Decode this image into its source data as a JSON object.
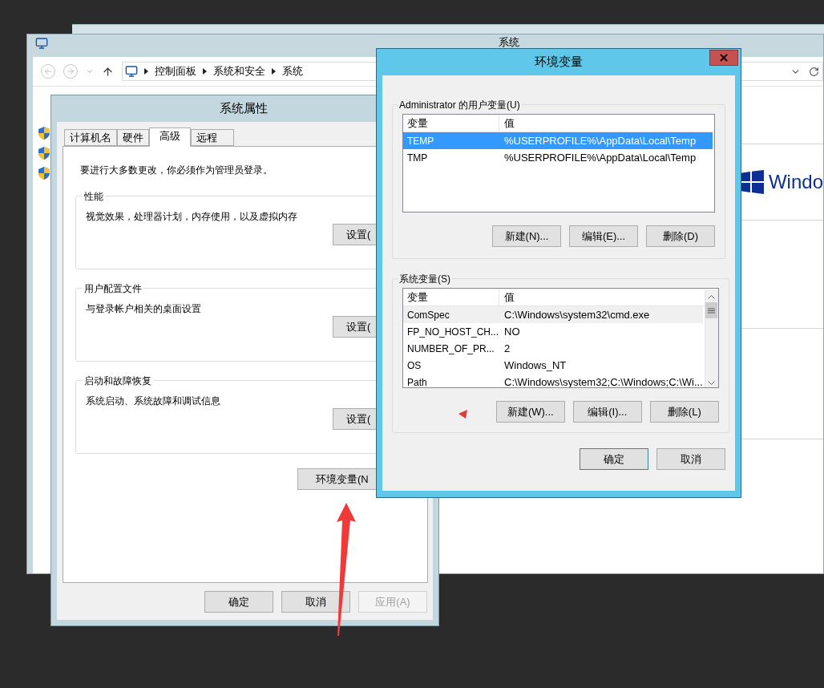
{
  "system_window": {
    "title": "系统",
    "breadcrumb": [
      "控制面板",
      "系统和安全",
      "系统"
    ],
    "logo_text": "Windo"
  },
  "system_properties": {
    "title": "系统属性",
    "tabs": [
      {
        "label": "计算机名",
        "selected": false
      },
      {
        "label": "硬件",
        "selected": false
      },
      {
        "label": "高级",
        "selected": true
      },
      {
        "label": "远程",
        "selected": false
      }
    ],
    "notice": "要进行大多数更改，你必须作为管理员登录。",
    "groups": [
      {
        "title": "性能",
        "description": "视觉效果，处理器计划，内存使用，以及虚拟内存",
        "button": "设置("
      },
      {
        "title": "用户配置文件",
        "description": "与登录帐户相关的桌面设置",
        "button": "设置("
      },
      {
        "title": "启动和故障恢复",
        "description": "系统启动、系统故障和调试信息",
        "button": "设置("
      }
    ],
    "env_button": "环境变量(N",
    "buttons": [
      {
        "label": "确定",
        "disabled": false
      },
      {
        "label": "取消",
        "disabled": false
      },
      {
        "label": "应用(A)",
        "disabled": true
      }
    ]
  },
  "env_dialog": {
    "title": "环境变量",
    "lists": [
      {
        "title": "Administrator 的用户变量(U)",
        "focused": true,
        "columns": [
          "变量",
          "值"
        ],
        "rows": [
          {
            "name": "TEMP",
            "value": "%USERPROFILE%\\AppData\\Local\\Temp",
            "selected": true
          },
          {
            "name": "TMP",
            "value": "%USERPROFILE%\\AppData\\Local\\Temp",
            "selected": false
          }
        ],
        "buttons": [
          "新建(N)...",
          "编辑(E)...",
          "删除(D)"
        ]
      },
      {
        "title": "系统变量(S)",
        "focused": false,
        "columns": [
          "变量",
          "值"
        ],
        "rows": [
          {
            "name": "ComSpec",
            "value": "C:\\Windows\\system32\\cmd.exe",
            "selected": true
          },
          {
            "name": "FP_NO_HOST_CH...",
            "value": "NO",
            "selected": false
          },
          {
            "name": "NUMBER_OF_PR...",
            "value": "2",
            "selected": false
          },
          {
            "name": "OS",
            "value": "Windows_NT",
            "selected": false
          },
          {
            "name": "Path",
            "value": "C:\\Windows\\system32;C:\\Windows;C:\\Wi...",
            "selected": false
          }
        ],
        "buttons": [
          "新建(W)...",
          "编辑(I)...",
          "删除(L)"
        ]
      }
    ],
    "buttons": [
      {
        "label": "确定",
        "default": true
      },
      {
        "label": "取消",
        "default": false
      }
    ]
  }
}
